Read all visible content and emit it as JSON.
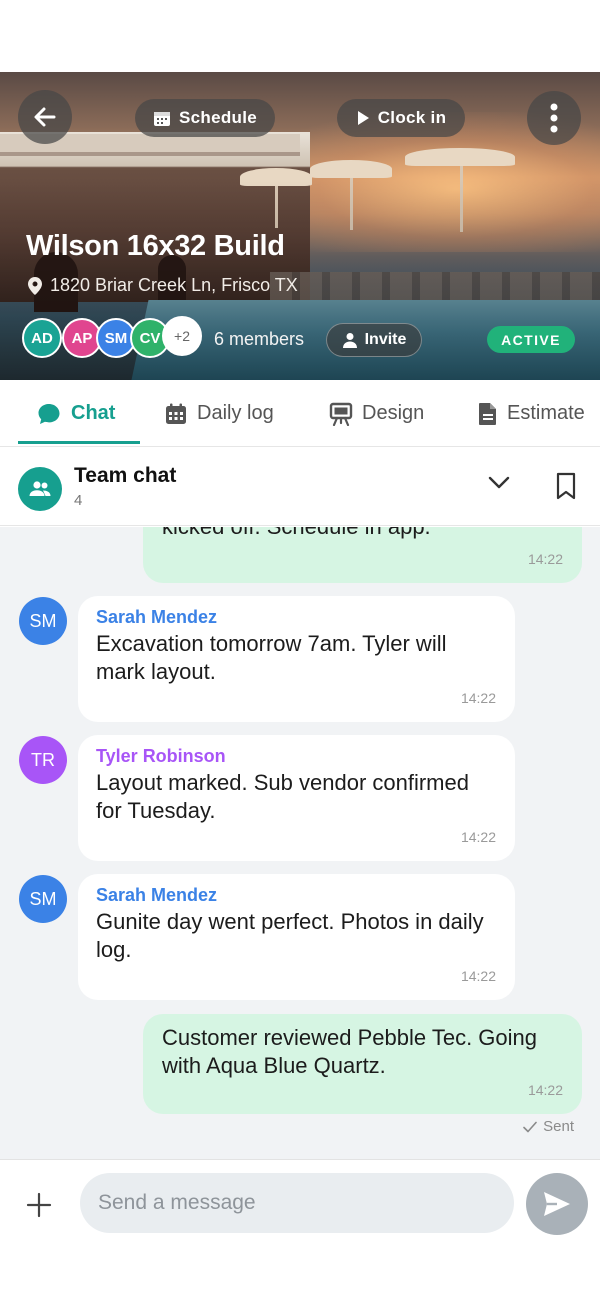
{
  "hero": {
    "back_icon": "arrow-left-icon",
    "schedule_label": "Schedule",
    "clock_in_label": "Clock in",
    "more_icon": "more-vertical-icon",
    "title": "Wilson 16x32 Build",
    "address": "1820 Briar Creek Ln, Frisco TX",
    "avatars": [
      {
        "initials": "AD",
        "color": "#1aa394"
      },
      {
        "initials": "AP",
        "color": "#e0458f"
      },
      {
        "initials": "SM",
        "color": "#3b82e6"
      },
      {
        "initials": "CV",
        "color": "#2fb26a"
      }
    ],
    "avatar_overflow": "+2",
    "members_label": "6 members",
    "invite_label": "Invite",
    "status_label": "ACTIVE",
    "status_color": "#21b27a"
  },
  "tabs": [
    {
      "label": "Chat",
      "icon": "chat-bubble-icon",
      "active": true
    },
    {
      "label": "Daily log",
      "icon": "calendar-icon",
      "active": false
    },
    {
      "label": "Design",
      "icon": "easel-icon",
      "active": false
    },
    {
      "label": "Estimate",
      "icon": "document-icon",
      "active": false
    }
  ],
  "chat_header": {
    "title": "Team chat",
    "count": "4",
    "group_icon": "group-icon",
    "expand_icon": "chevron-down-icon",
    "bookmark_icon": "bookmark-icon"
  },
  "messages": [
    {
      "direction": "out",
      "text": "kicked off. Schedule in app.",
      "time": "14:22"
    },
    {
      "direction": "in",
      "initials": "SM",
      "avatar_color": "#3b82e6",
      "sender": "Sarah Mendez",
      "sender_color": "#3b82e6",
      "text": "Excavation tomorrow 7am. Tyler will mark layout.",
      "time": "14:22"
    },
    {
      "direction": "in",
      "initials": "TR",
      "avatar_color": "#a855f7",
      "sender": "Tyler Robinson",
      "sender_color": "#a855f7",
      "text": "Layout marked. Sub vendor confirmed for Tuesday.",
      "time": "14:22"
    },
    {
      "direction": "in",
      "initials": "SM",
      "avatar_color": "#3b82e6",
      "sender": "Sarah Mendez",
      "sender_color": "#3b82e6",
      "text": "Gunite day went perfect. Photos in daily log.",
      "time": "14:22"
    },
    {
      "direction": "out",
      "text": "Customer reviewed Pebble Tec. Going with Aqua Blue Quartz.",
      "time": "14:22"
    }
  ],
  "sent_label": "Sent",
  "composer": {
    "placeholder": "Send a message",
    "add_icon": "plus-icon",
    "send_icon": "send-icon"
  }
}
